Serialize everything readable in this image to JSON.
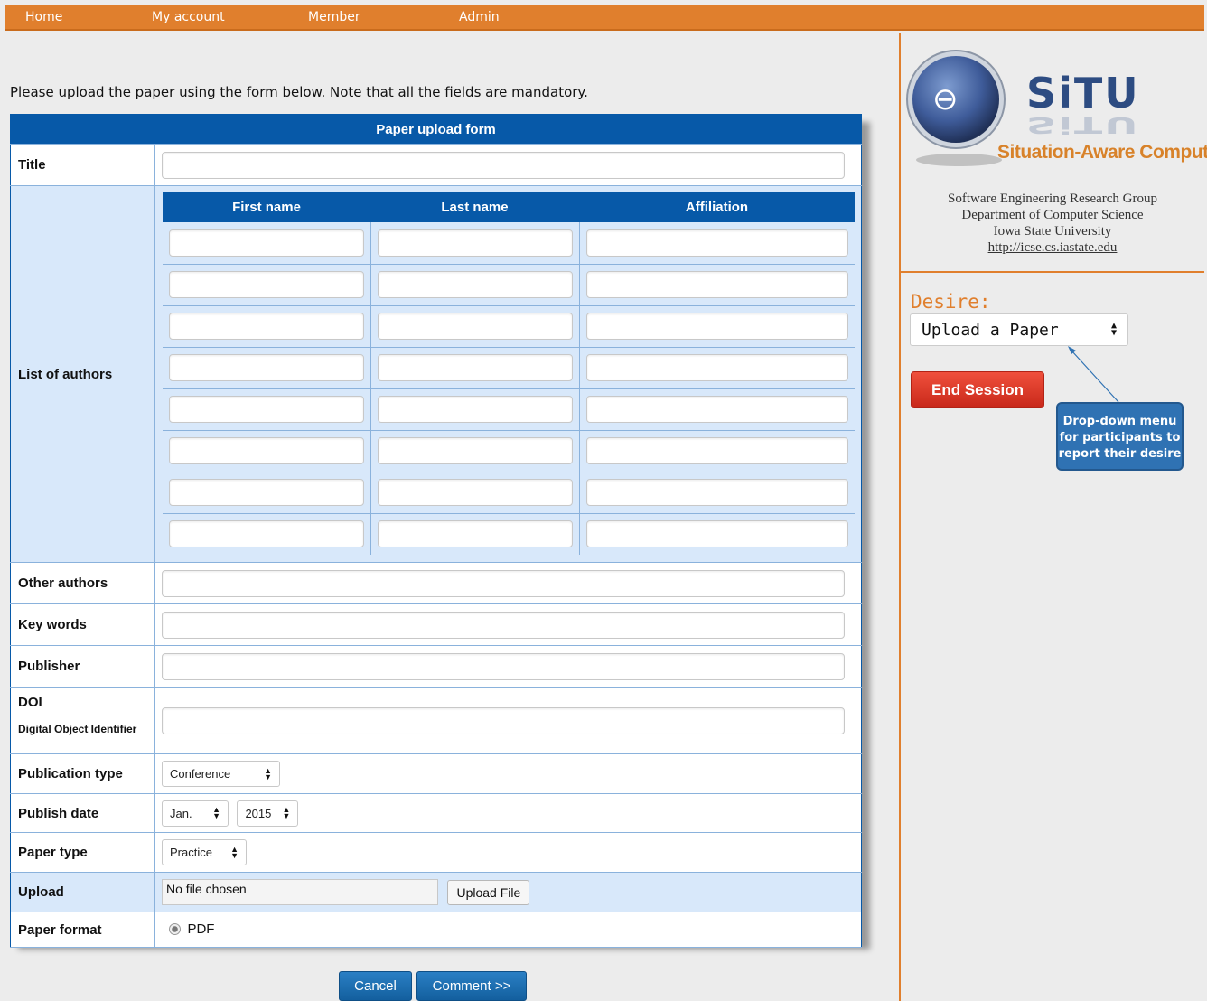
{
  "nav": [
    "Home",
    "My account",
    "Member",
    "Admin"
  ],
  "intro": "Please upload the paper using the form below. Note that all the fields are mandatory.",
  "form": {
    "header": "Paper upload form",
    "labels": {
      "title": "Title",
      "authors": "List of authors",
      "other_authors": "Other authors",
      "keywords": "Key words",
      "publisher": "Publisher",
      "doi": "DOI",
      "doi_sub": "Digital Object Identifier",
      "publication_type": "Publication type",
      "publish_date": "Publish date",
      "paper_type": "Paper type",
      "upload": "Upload",
      "paper_format": "Paper format"
    },
    "author_columns": [
      "First name",
      "Last name",
      "Affiliation"
    ],
    "author_rows": 8,
    "publication_type_value": "Conference",
    "publish_month_value": "Jan.",
    "publish_year_value": "2015",
    "paper_type_value": "Practice",
    "file_status": "No file chosen",
    "upload_button": "Upload File",
    "format_option": "PDF"
  },
  "buttons": {
    "cancel": "Cancel",
    "comment": "Comment >>"
  },
  "sidebar": {
    "logo_text": "SiTU",
    "logo_tagline": "Situation-Aware Computing",
    "org_lines": [
      "Software Engineering Research Group",
      "Department of Computer Science",
      "Iowa State University"
    ],
    "org_link": "http://icse.cs.iastate.edu",
    "desire_label": "Desire:",
    "desire_value": "Upload a Paper",
    "end_session": "End Session",
    "callout": "Drop-down menu for participants to report their desire"
  },
  "colors": {
    "nav": "#e07f2d",
    "form_header": "#0759a8",
    "row_blue": "#d8e8fa",
    "end_button": "#e0402c",
    "callout": "#2f72b3"
  }
}
